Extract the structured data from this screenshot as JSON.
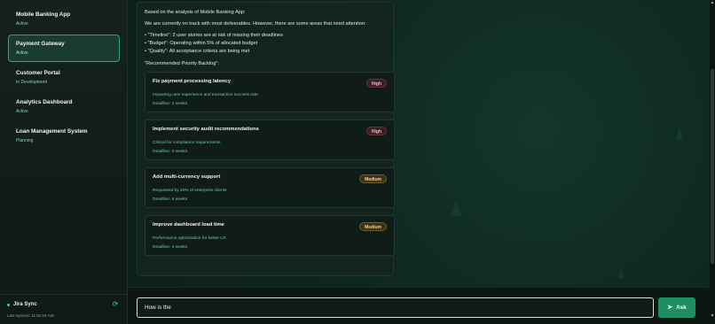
{
  "sidebar": {
    "projects": [
      {
        "name": "Mobile Banking App",
        "status": "Active"
      },
      {
        "name": "Payment Gateway",
        "status": "Active"
      },
      {
        "name": "Customer Portal",
        "status": "In Development"
      },
      {
        "name": "Analytics Dashboard",
        "status": "Active"
      },
      {
        "name": "Loan Management System",
        "status": "Planning"
      }
    ],
    "footer": {
      "sync_label": "Jira Sync",
      "last_synced": "Last synced: 11:01:24 AM",
      "refresh_icon": "refresh-icon"
    }
  },
  "message": {
    "intro": "Based on the analysis of Mobile Banking App:",
    "summary": "We are currently on track with most deliverables. However, there are some areas that need attention:",
    "bullets": [
      "• \"Timeline\": 2 user stories are at risk of missing their deadlines",
      "• \"Budget\": Operating within 5% of allocated budget",
      "• \"Quality\": All acceptance criteria are being met"
    ],
    "backlog_title": "\"Recommended Priority Backlog\":",
    "backlog": [
      {
        "title": "Fix payment processing latency",
        "priority": "High",
        "description": "Impacting user experience and transaction success rate",
        "deadline": "Deadline: 2 weeks"
      },
      {
        "title": "Implement security audit recommendations",
        "priority": "High",
        "description": "Critical for compliance requirements",
        "deadline": "Deadline: 3 weeks"
      },
      {
        "title": "Add multi-currency support",
        "priority": "Medium",
        "description": "Requested by 40% of enterprise clients",
        "deadline": "Deadline: 6 weeks"
      },
      {
        "title": "Improve dashboard load time",
        "priority": "Medium",
        "description": "Performance optimization for better UX",
        "deadline": "Deadline: 4 weeks"
      }
    ]
  },
  "input": {
    "value": "How is the",
    "ask_label": "Ask",
    "send_icon": "send-icon"
  },
  "colors": {
    "accent": "#1f8f63",
    "active_border": "#2fa77a",
    "high_badge": "#ffb3b8",
    "medium_badge": "#ffd37a"
  }
}
